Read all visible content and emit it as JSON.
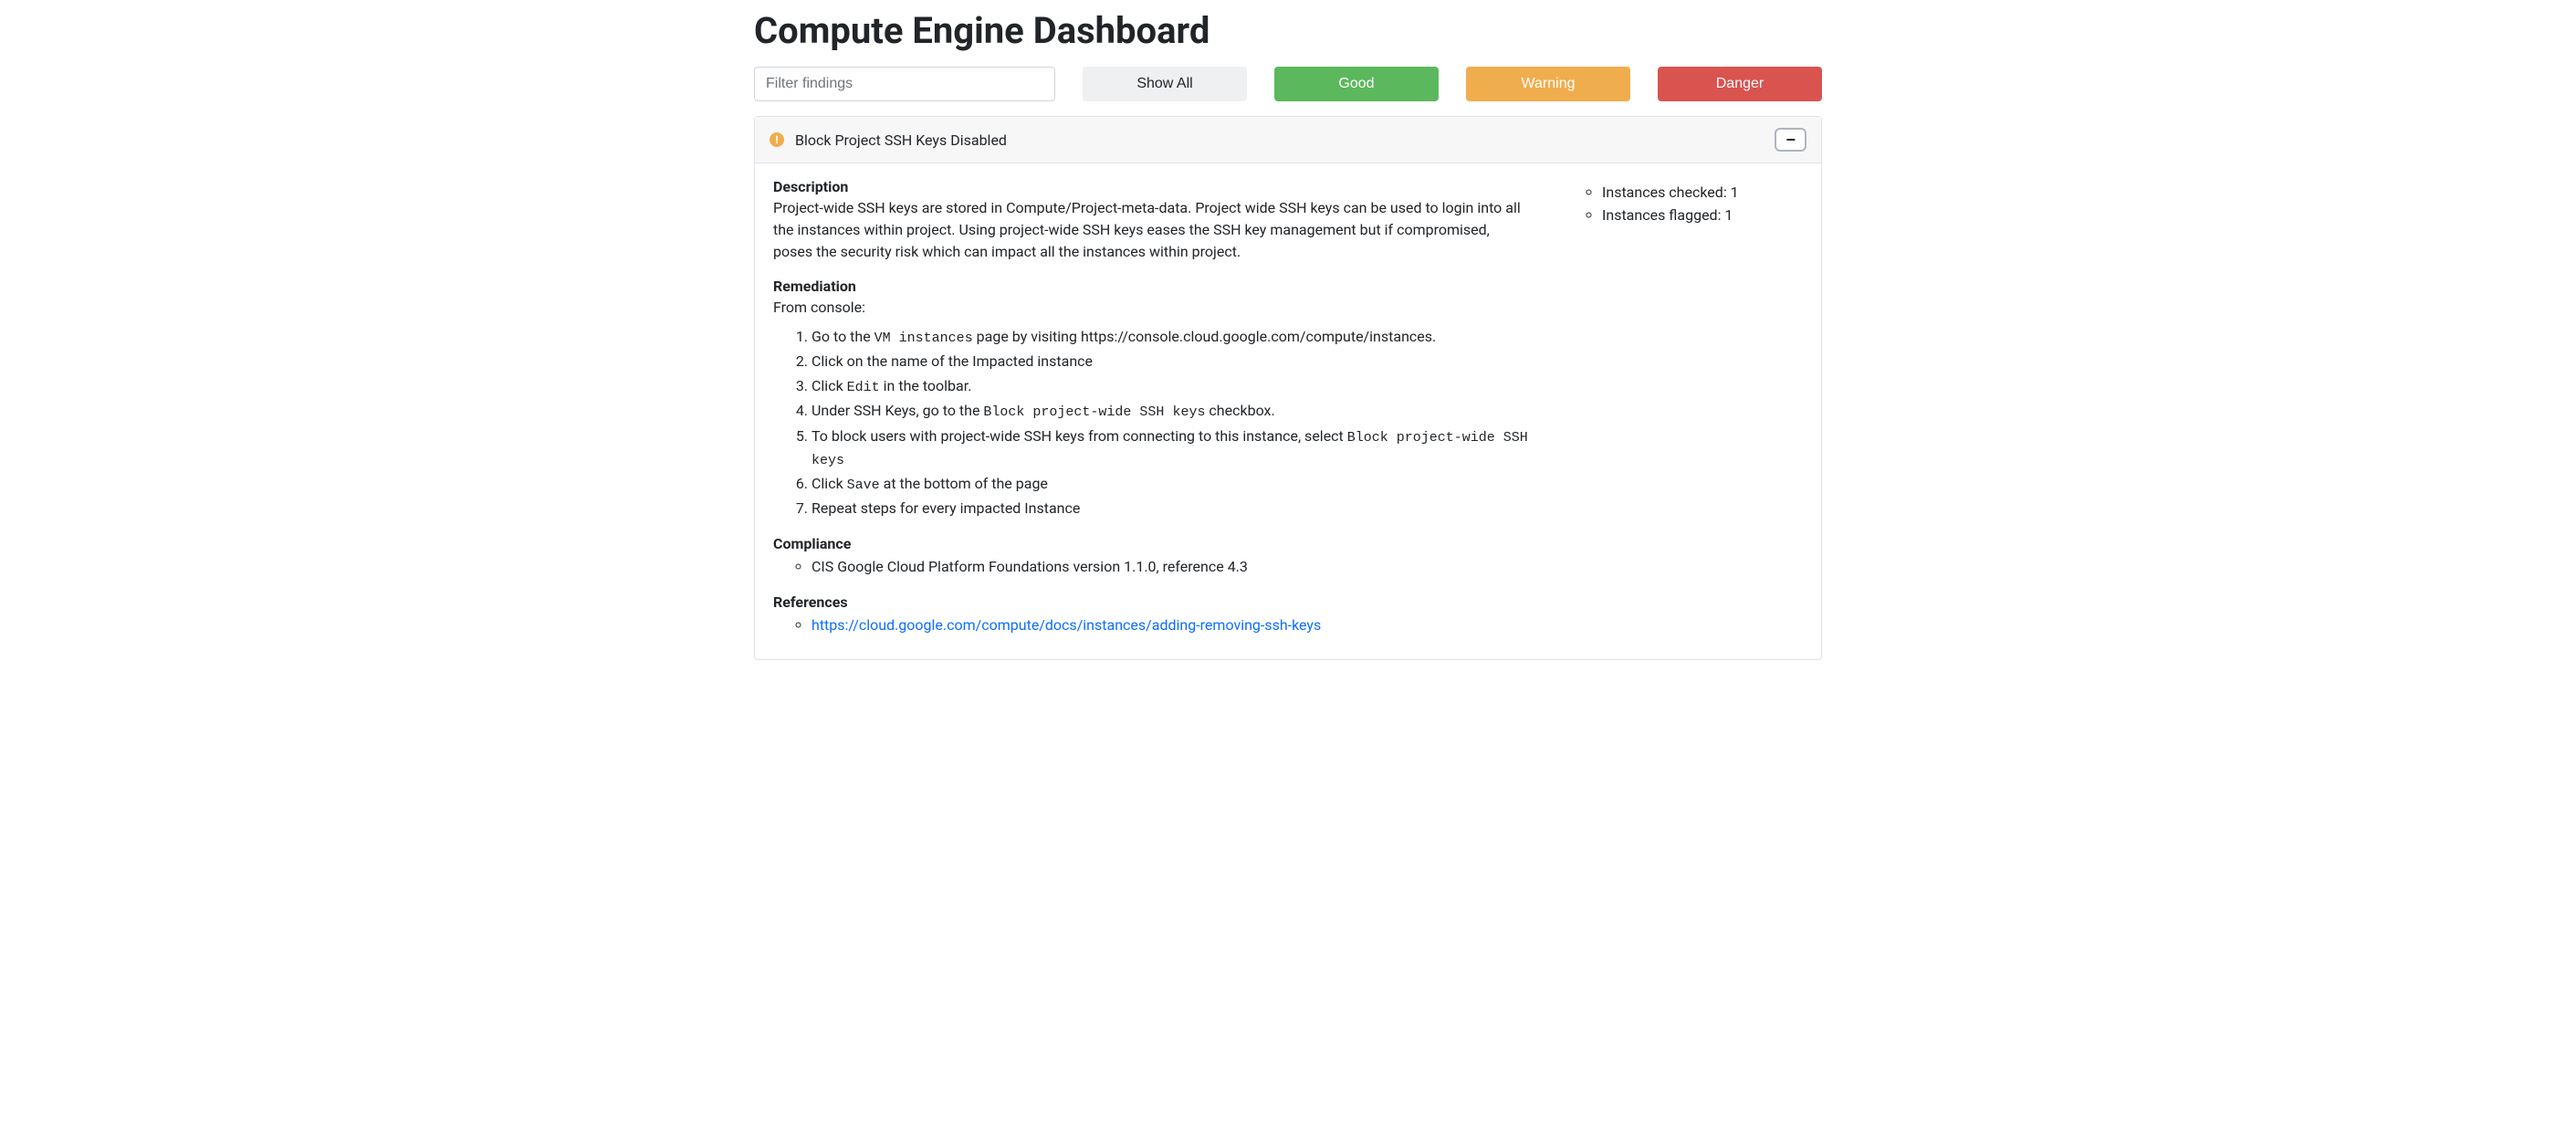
{
  "title": "Compute Engine Dashboard",
  "filter": {
    "placeholder": "Filter findings"
  },
  "buttons": {
    "show_all": "Show All",
    "good": "Good",
    "warning": "Warning",
    "danger": "Danger"
  },
  "finding": {
    "status_icon": "!",
    "status": "warning",
    "title": "Block Project SSH Keys Disabled",
    "collapse_glyph": "−",
    "description_label": "Description",
    "description": "Project-wide SSH keys are stored in Compute/Project-meta-data. Project wide SSH keys can be used to login into all the instances within project. Using project-wide SSH keys eases the SSH key management but if compromised, poses the security risk which can impact all the instances within project.",
    "remediation_label": "Remediation",
    "remediation_intro": "From console:",
    "steps": {
      "s1_a": "Go to the ",
      "s1_code": "VM instances",
      "s1_b": " page by visiting https://console.cloud.google.com/compute/instances.",
      "s2": "Click on the name of the Impacted instance",
      "s3_a": "Click ",
      "s3_code": "Edit",
      "s3_b": " in the toolbar.",
      "s4_a": "Under SSH Keys, go to the ",
      "s4_code": "Block project-wide SSH keys",
      "s4_b": " checkbox.",
      "s5_a": "To block users with project-wide SSH keys from connecting to this instance, select ",
      "s5_code": "Block project-wide SSH keys",
      "s6_a": "Click ",
      "s6_code": "Save",
      "s6_b": " at the bottom of the page",
      "s7": "Repeat steps for every impacted Instance"
    },
    "compliance_label": "Compliance",
    "compliance_item": "CIS Google Cloud Platform Foundations version 1.1.0, reference 4.3",
    "references_label": "References",
    "reference_link": "https://cloud.google.com/compute/docs/instances/adding-removing-ssh-keys",
    "stats": {
      "checked_label": "Instances checked: ",
      "checked_value": "1",
      "flagged_label": "Instances flagged: ",
      "flagged_value": "1"
    }
  }
}
